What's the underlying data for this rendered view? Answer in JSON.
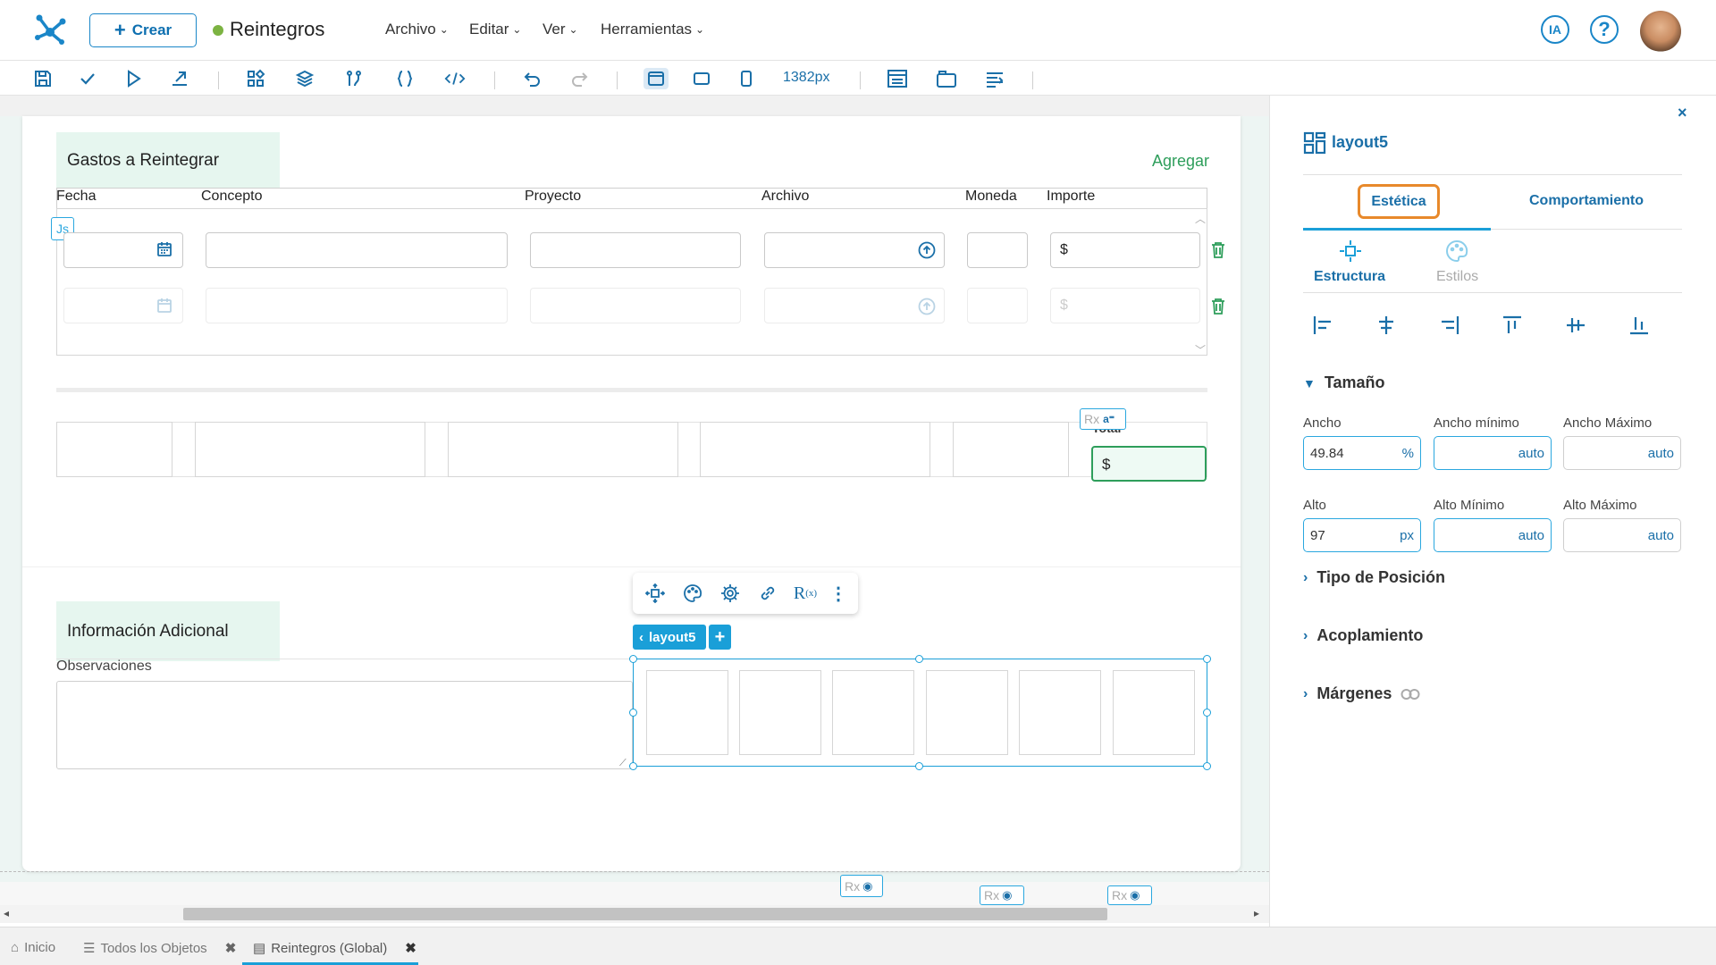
{
  "header": {
    "create_label": "Crear",
    "app_title": "Reintegros",
    "menus": [
      "Archivo",
      "Editar",
      "Ver",
      "Herramientas"
    ],
    "ia_label": "IA"
  },
  "toolbar": {
    "width_value": "1382px"
  },
  "gastos": {
    "title": "Gastos a Reintegrar",
    "add_label": "Agregar",
    "columns": [
      "Fecha",
      "Concepto",
      "Proyecto",
      "Archivo",
      "Moneda",
      "Importe"
    ],
    "js_badge": "Js",
    "currency": "$",
    "total_label": "Total",
    "rx_badge": "Rx"
  },
  "info": {
    "title": "Información Adicional",
    "observaciones_label": "Observaciones",
    "layout_tag": "layout5"
  },
  "panel": {
    "close": "×",
    "component_name": "layout5",
    "tabs": [
      "Estética",
      "Comportamiento"
    ],
    "subtabs": [
      "Estructura",
      "Estilos"
    ],
    "size_section": "Tamaño",
    "fields": [
      {
        "label": "Ancho",
        "value": "49.84",
        "unit": "%"
      },
      {
        "label": "Ancho mínimo",
        "value": "auto",
        "unit": ""
      },
      {
        "label": "Ancho Máximo",
        "value": "auto",
        "unit": ""
      },
      {
        "label": "Alto",
        "value": "97",
        "unit": "px"
      },
      {
        "label": "Alto Mínimo",
        "value": "auto",
        "unit": ""
      },
      {
        "label": "Alto Máximo",
        "value": "auto",
        "unit": ""
      }
    ],
    "sections": [
      "Tipo de Posición",
      "Acoplamiento",
      "Márgenes"
    ]
  },
  "bottom_tabs": [
    {
      "label": "Inicio"
    },
    {
      "label": "Todos los Objetos"
    },
    {
      "label": "Reintegros (Global)"
    }
  ],
  "colors": {
    "primary": "#0d6fb0",
    "accent": "#1a9fd8",
    "green": "#2e9e5b",
    "highlight": "#e8892b"
  }
}
